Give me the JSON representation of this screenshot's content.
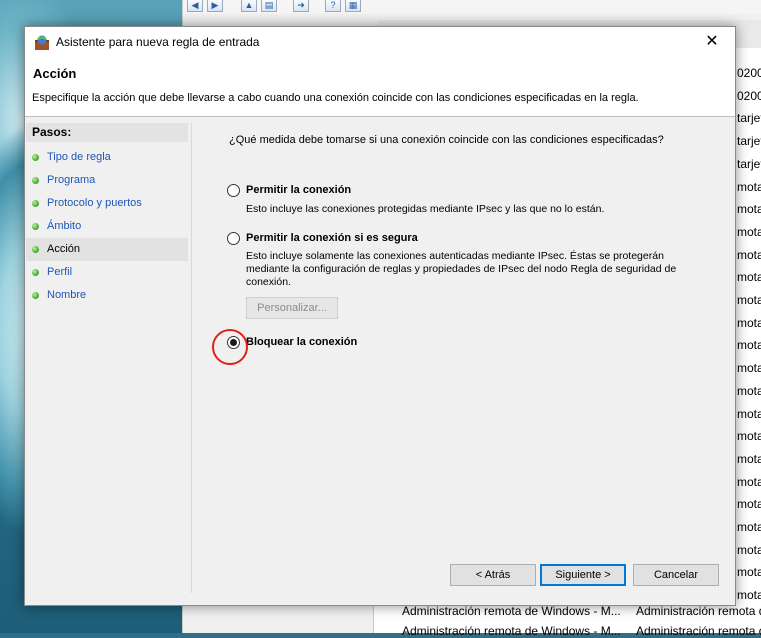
{
  "background": {
    "right_column_text": [
      "0200",
      "0200",
      "tarjet",
      "tarjet",
      "tarjet",
      "mota",
      "mota",
      "mota",
      "mota",
      "mota",
      "mota",
      "mota",
      "mota",
      "mota",
      "mota",
      "mota",
      "mota",
      "mota",
      "mota",
      "mota",
      "mota",
      "mota",
      "mota",
      "mota",
      "mota"
    ],
    "bottom_rows": [
      {
        "name": "Administración remota de Windows - M...",
        "group": "Administración remota d"
      },
      {
        "name": "Administración remota de Windows - M...",
        "group": "Administración remota d"
      }
    ]
  },
  "dialog": {
    "title": "Asistente para nueva regla de entrada",
    "close_label": "✕",
    "header_title": "Acción",
    "header_desc": "Especifique la acción que debe llevarse a cabo cuando una conexión coincide con las condiciones especificadas en la regla.",
    "steps_title": "Pasos:",
    "steps": [
      {
        "label": "Tipo de regla"
      },
      {
        "label": "Programa"
      },
      {
        "label": "Protocolo y puertos"
      },
      {
        "label": "Ámbito"
      },
      {
        "label": "Acción"
      },
      {
        "label": "Perfil"
      },
      {
        "label": "Nombre"
      }
    ],
    "current_step": "Acción",
    "question": "¿Qué medida debe tomarse si una conexión coincide con las condiciones especificadas?",
    "options": [
      {
        "label": "Permitir la conexión",
        "desc": "Esto incluye las conexiones protegidas mediante IPsec y las que no lo están.",
        "checked": false
      },
      {
        "label": "Permitir la conexión si es segura",
        "desc_lines": [
          "Esto incluye solamente las conexiones autenticadas mediante IPsec. Éstas se protegerán",
          "mediante la configuración de reglas y propiedades de IPsec del nodo Regla de seguridad de",
          "conexión."
        ],
        "checked": false
      },
      {
        "label": "Bloquear la conexión",
        "checked": true
      }
    ],
    "customize_label": "Personalizar...",
    "buttons": {
      "back": "< Atrás",
      "next": "Siguiente >",
      "cancel": "Cancelar"
    },
    "colors": {
      "link": "#1e56b8",
      "highlight": "#e0201b",
      "accent": "#0078d7"
    }
  }
}
